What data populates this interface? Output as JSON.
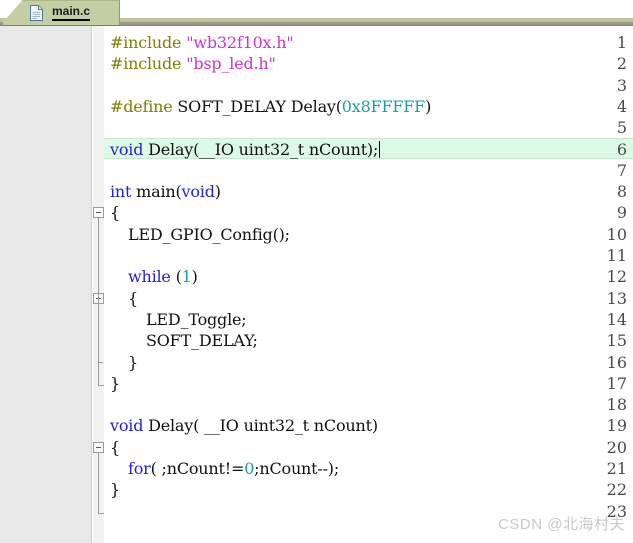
{
  "tab": {
    "label": "main.c",
    "icon": "document-icon"
  },
  "watermark": "CSDN @北海村夫",
  "colors": {
    "preprocessor": "#808000",
    "string": "#cc33cc",
    "keyword": "#2222dd",
    "number": "#1a9e9e",
    "plain": "#111111",
    "current_line_highlight": "#ddfbe4",
    "gutter_bg": "#e8e8e8",
    "tab_bg": "#c3cfa3"
  },
  "editor": {
    "current_line": 6,
    "total_lines": 23,
    "lines": [
      {
        "n": "1",
        "indent": 0,
        "tokens": [
          {
            "t": "pre",
            "v": "#include"
          },
          {
            "t": "def",
            "v": " "
          },
          {
            "t": "str",
            "v": "\"wb32f10x.h\""
          }
        ]
      },
      {
        "n": "2",
        "indent": 0,
        "tokens": [
          {
            "t": "pre",
            "v": "#include"
          },
          {
            "t": "def",
            "v": " "
          },
          {
            "t": "str",
            "v": "\"bsp_led.h\""
          }
        ]
      },
      {
        "n": "3",
        "indent": 0,
        "tokens": []
      },
      {
        "n": "4",
        "indent": 0,
        "tokens": [
          {
            "t": "pre",
            "v": "#define"
          },
          {
            "t": "def",
            "v": " SOFT_DELAY Delay("
          },
          {
            "t": "num",
            "v": "0x8FFFFF"
          },
          {
            "t": "def",
            "v": ")"
          }
        ]
      },
      {
        "n": "5",
        "indent": 0,
        "tokens": []
      },
      {
        "n": "6",
        "indent": 0,
        "tokens": [
          {
            "t": "kw",
            "v": "void"
          },
          {
            "t": "def",
            "v": " Delay(__IO uint32_t nCount);"
          }
        ]
      },
      {
        "n": "7",
        "indent": 0,
        "tokens": []
      },
      {
        "n": "8",
        "indent": 0,
        "tokens": [
          {
            "t": "kw",
            "v": "int"
          },
          {
            "t": "def",
            "v": " main("
          },
          {
            "t": "kw",
            "v": "void"
          },
          {
            "t": "def",
            "v": ")"
          }
        ]
      },
      {
        "n": "9",
        "indent": 0,
        "tokens": [
          {
            "t": "def",
            "v": "{"
          }
        ]
      },
      {
        "n": "10",
        "indent": 1,
        "tokens": [
          {
            "t": "def",
            "v": "LED_GPIO_Config();"
          }
        ]
      },
      {
        "n": "11",
        "indent": 0,
        "tokens": []
      },
      {
        "n": "12",
        "indent": 1,
        "tokens": [
          {
            "t": "kw",
            "v": "while"
          },
          {
            "t": "def",
            "v": " ("
          },
          {
            "t": "num",
            "v": "1"
          },
          {
            "t": "def",
            "v": ")"
          }
        ]
      },
      {
        "n": "13",
        "indent": 1,
        "tokens": [
          {
            "t": "def",
            "v": "{"
          }
        ]
      },
      {
        "n": "14",
        "indent": 2,
        "tokens": [
          {
            "t": "def",
            "v": "LED_Toggle;"
          }
        ]
      },
      {
        "n": "15",
        "indent": 2,
        "tokens": [
          {
            "t": "def",
            "v": "SOFT_DELAY;"
          }
        ]
      },
      {
        "n": "16",
        "indent": 1,
        "tokens": [
          {
            "t": "def",
            "v": "}"
          }
        ]
      },
      {
        "n": "17",
        "indent": 0,
        "tokens": [
          {
            "t": "def",
            "v": "}"
          }
        ]
      },
      {
        "n": "18",
        "indent": 0,
        "tokens": []
      },
      {
        "n": "19",
        "indent": 0,
        "tokens": [
          {
            "t": "kw",
            "v": "void"
          },
          {
            "t": "def",
            "v": " Delay( __IO uint32_t nCount)"
          }
        ]
      },
      {
        "n": "20",
        "indent": 0,
        "tokens": [
          {
            "t": "def",
            "v": "{"
          }
        ]
      },
      {
        "n": "21",
        "indent": 1,
        "tokens": [
          {
            "t": "kw",
            "v": "for"
          },
          {
            "t": "def",
            "v": "( ;nCount!="
          },
          {
            "t": "num",
            "v": "0"
          },
          {
            "t": "def",
            "v": ";nCount--);"
          }
        ]
      },
      {
        "n": "22",
        "indent": 0,
        "tokens": [
          {
            "t": "def",
            "v": "}"
          }
        ]
      },
      {
        "n": "23",
        "indent": 0,
        "tokens": []
      }
    ],
    "folds": [
      {
        "line": 9,
        "type": "box"
      },
      {
        "line": 13,
        "type": "box"
      },
      {
        "line": 16,
        "type": "tick"
      },
      {
        "line": 17,
        "type": "end"
      },
      {
        "line": 20,
        "type": "box"
      },
      {
        "line": 23,
        "type": "end"
      }
    ]
  }
}
